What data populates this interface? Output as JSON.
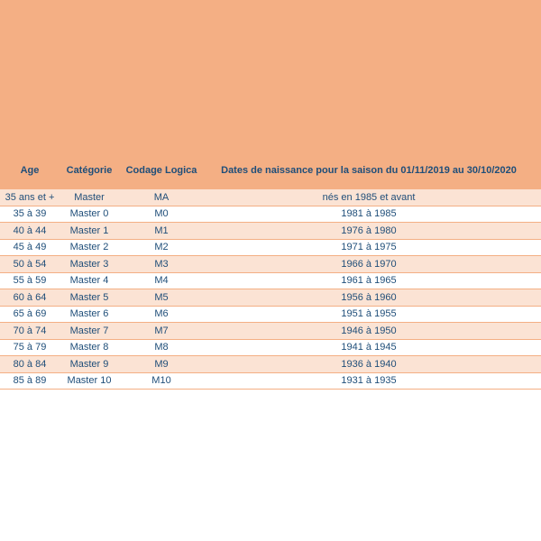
{
  "table": {
    "headers": [
      "Age",
      "Catégorie",
      "Codage Logica",
      "Dates de naissance pour la saison du 01/11/2019 au 30/10/2020"
    ],
    "rows": [
      [
        "35 ans et +",
        "Master",
        "MA",
        "nés en 1985 et avant"
      ],
      [
        "35 à 39",
        "Master 0",
        "M0",
        "1981 à 1985"
      ],
      [
        "40 à 44",
        "Master 1",
        "M1",
        "1976 à 1980"
      ],
      [
        "45 à 49",
        "Master 2",
        "M2",
        "1971 à 1975"
      ],
      [
        "50 à 54",
        "Master 3",
        "M3",
        "1966 à 1970"
      ],
      [
        "55 à 59",
        "Master 4",
        "M4",
        "1961 à 1965"
      ],
      [
        "60 à 64",
        "Master 5",
        "M5",
        "1956 à 1960"
      ],
      [
        "65 à 69",
        "Master 6",
        "M6",
        "1951 à 1955"
      ],
      [
        "70 à 74",
        "Master 7",
        "M7",
        "1946 à 1950"
      ],
      [
        "75 à 79",
        "Master 8",
        "M8",
        "1941 à 1945"
      ],
      [
        "80 à 84",
        "Master 9",
        "M9",
        "1936 à 1940"
      ],
      [
        "85 à 89",
        "Master 10",
        "M10",
        "1931 à 1935"
      ]
    ]
  },
  "colors": {
    "header_band": "#f4af84",
    "row_tint": "#fbe3d4",
    "text": "#1f4e79"
  }
}
